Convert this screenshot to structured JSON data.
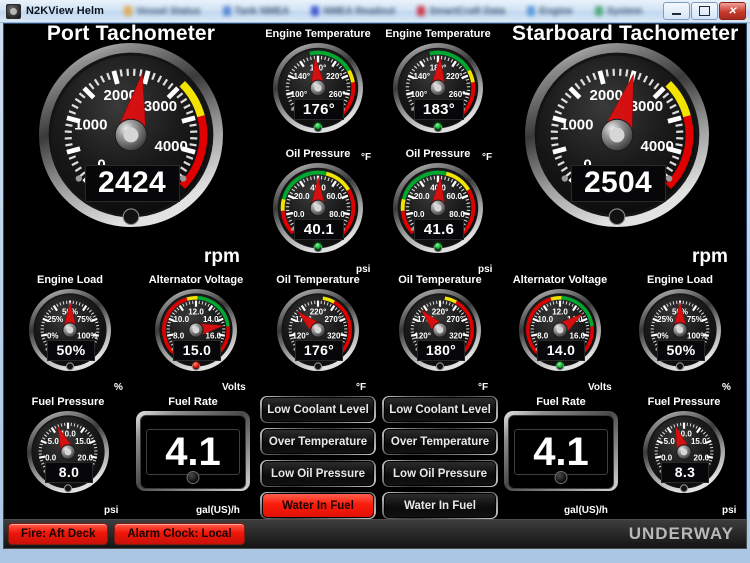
{
  "window": {
    "title": "N2KView Helm",
    "app_icon": "app-icon",
    "tabs": [
      {
        "label": "Vessel Status",
        "dot": "#e2a33a"
      },
      {
        "label": "Tank NMEA",
        "dot": "#4a7fd0"
      },
      {
        "label": "NMEA Readout",
        "dot": "#2a46c8"
      },
      {
        "label": "SmartCraft Data",
        "dot": "#cc2233"
      },
      {
        "label": "Engine",
        "dot": "#4a8fd8"
      },
      {
        "label": "System",
        "dot": "#3fa06a"
      }
    ],
    "controls": {
      "minimize": "minimize-button",
      "maximize": "maximize-button",
      "close": "close-button"
    }
  },
  "status_bar": {
    "alarms": [
      "Fire: Aft Deck",
      "Alarm Clock: Local"
    ],
    "vessel_state": "UNDERWAY"
  },
  "alarm_buttons": {
    "port": [
      {
        "label": "Low Coolant Level",
        "active": false
      },
      {
        "label": "Over Temperature",
        "active": false
      },
      {
        "label": "Low Oil Pressure",
        "active": false
      },
      {
        "label": "Water In Fuel",
        "active": true
      }
    ],
    "starboard": [
      {
        "label": "Low Coolant Level",
        "active": false
      },
      {
        "label": "Over Temperature",
        "active": false
      },
      {
        "label": "Low Oil Pressure",
        "active": false
      },
      {
        "label": "Water In Fuel",
        "active": false
      }
    ]
  },
  "colors": {
    "green": "#00a830",
    "yellow": "#f2e400",
    "red": "#e00000",
    "needle": "#d51010",
    "alarm_red": "#f01608",
    "text": "#ffffff"
  },
  "gauges": {
    "port_tach": {
      "title": "Port Tachometer",
      "value": "2424",
      "unit": "rpm",
      "min": 0,
      "max": 4500,
      "value_num": 2424,
      "ticks": [
        {
          "v": 0,
          "label": "0"
        },
        {
          "v": 1000,
          "label": "1000"
        },
        {
          "v": 2000,
          "label": "2000"
        },
        {
          "v": 3000,
          "label": "3000"
        },
        {
          "v": 4000,
          "label": "4000"
        }
      ],
      "bands": [
        {
          "from": 3000,
          "to": 3500,
          "color": "#f2e400"
        },
        {
          "from": 3500,
          "to": 4500,
          "color": "#e00000"
        }
      ],
      "led": null
    },
    "stbd_tach": {
      "title": "Starboard Tachometer",
      "value": "2504",
      "unit": "rpm",
      "min": 0,
      "max": 4500,
      "value_num": 2504,
      "ticks": [
        {
          "v": 0,
          "label": "0"
        },
        {
          "v": 1000,
          "label": "1000"
        },
        {
          "v": 2000,
          "label": "2000"
        },
        {
          "v": 3000,
          "label": "3000"
        },
        {
          "v": 4000,
          "label": "4000"
        }
      ],
      "bands": [
        {
          "from": 3000,
          "to": 3500,
          "color": "#f2e400"
        },
        {
          "from": 3500,
          "to": 4500,
          "color": "#e00000"
        }
      ],
      "led": null
    },
    "port_engine_temp": {
      "title": "Engine Temperature",
      "value": "176°",
      "unit": "°F",
      "min": 80,
      "max": 280,
      "value_num": 176,
      "ticks": [
        {
          "v": 100,
          "label": "100°"
        },
        {
          "v": 140,
          "label": "140°"
        },
        {
          "v": 180,
          "label": "180°"
        },
        {
          "v": 220,
          "label": "220°"
        },
        {
          "v": 260,
          "label": "260°"
        }
      ],
      "bands": [
        {
          "from": 170,
          "to": 225,
          "color": "#00a830"
        },
        {
          "from": 225,
          "to": 240,
          "color": "#f2e400"
        },
        {
          "from": 240,
          "to": 280,
          "color": "#e00000"
        }
      ],
      "led": "green"
    },
    "stbd_engine_temp": {
      "title": "Engine Temperature",
      "value": "183°",
      "unit": "°F",
      "min": 80,
      "max": 280,
      "value_num": 183,
      "ticks": [
        {
          "v": 100,
          "label": "100°"
        },
        {
          "v": 140,
          "label": "140°"
        },
        {
          "v": 180,
          "label": "180°"
        },
        {
          "v": 220,
          "label": "220°"
        },
        {
          "v": 260,
          "label": "260°"
        }
      ],
      "bands": [
        {
          "from": 170,
          "to": 225,
          "color": "#00a830"
        },
        {
          "from": 225,
          "to": 240,
          "color": "#f2e400"
        },
        {
          "from": 240,
          "to": 280,
          "color": "#e00000"
        }
      ],
      "led": "green"
    },
    "port_oil_press": {
      "title": "Oil Pressure",
      "value": "40.1",
      "unit": "psi",
      "min": -10,
      "max": 90,
      "value_num": 40.1,
      "ticks": [
        {
          "v": 0,
          "label": "0.0"
        },
        {
          "v": 20,
          "label": "20.0"
        },
        {
          "v": 40,
          "label": "40.0"
        },
        {
          "v": 60,
          "label": "60.0"
        },
        {
          "v": 80,
          "label": "80.0"
        }
      ],
      "bands": [
        {
          "from": -10,
          "to": 5,
          "color": "#e00000"
        },
        {
          "from": 5,
          "to": 12,
          "color": "#f2e400"
        },
        {
          "from": 12,
          "to": 45,
          "color": "#00a830"
        },
        {
          "from": 45,
          "to": 62,
          "color": "#f2e400"
        },
        {
          "from": 62,
          "to": 90,
          "color": "#e00000"
        }
      ],
      "led": "green"
    },
    "stbd_oil_press": {
      "title": "Oil Pressure",
      "value": "41.6",
      "unit": "psi",
      "min": -10,
      "max": 90,
      "value_num": 41.6,
      "ticks": [
        {
          "v": 0,
          "label": "0.0"
        },
        {
          "v": 20,
          "label": "20.0"
        },
        {
          "v": 40,
          "label": "40.0"
        },
        {
          "v": 60,
          "label": "60.0"
        },
        {
          "v": 80,
          "label": "80.0"
        }
      ],
      "bands": [
        {
          "from": -10,
          "to": 5,
          "color": "#e00000"
        },
        {
          "from": 5,
          "to": 12,
          "color": "#f2e400"
        },
        {
          "from": 12,
          "to": 45,
          "color": "#00a830"
        },
        {
          "from": 45,
          "to": 62,
          "color": "#f2e400"
        },
        {
          "from": 62,
          "to": 90,
          "color": "#e00000"
        }
      ],
      "led": "green"
    },
    "port_engine_load": {
      "title": "Engine Load",
      "value": "50%",
      "unit": "%",
      "min": -12,
      "max": 112,
      "value_num": 50,
      "ticks": [
        {
          "v": 0,
          "label": "0%"
        },
        {
          "v": 25,
          "label": "25%"
        },
        {
          "v": 50,
          "label": "50%"
        },
        {
          "v": 75,
          "label": "75%"
        },
        {
          "v": 100,
          "label": "100%"
        }
      ],
      "bands": [],
      "led": null
    },
    "stbd_engine_load": {
      "title": "Engine Load",
      "value": "50%",
      "unit": "%",
      "min": -12,
      "max": 112,
      "value_num": 50,
      "ticks": [
        {
          "v": 0,
          "label": "0%"
        },
        {
          "v": 25,
          "label": "25%"
        },
        {
          "v": 50,
          "label": "50%"
        },
        {
          "v": 75,
          "label": "75%"
        },
        {
          "v": 100,
          "label": "100%"
        }
      ],
      "bands": [],
      "led": null
    },
    "port_alt_volt": {
      "title": "Alternator Voltage",
      "value": "15.0",
      "unit": "Volts",
      "min": 7,
      "max": 17,
      "value_num": 15.0,
      "ticks": [
        {
          "v": 8,
          "label": "8.0"
        },
        {
          "v": 10,
          "label": "10.0"
        },
        {
          "v": 12,
          "label": "12.0"
        },
        {
          "v": 14,
          "label": "14.0"
        },
        {
          "v": 16,
          "label": "16.0"
        }
      ],
      "bands": [
        {
          "from": 7,
          "to": 11.4,
          "color": "#e00000"
        },
        {
          "from": 11.4,
          "to": 12.1,
          "color": "#f2e400"
        },
        {
          "from": 12.1,
          "to": 15.1,
          "color": "#00a830"
        },
        {
          "from": 15.1,
          "to": 17,
          "color": "#e00000"
        }
      ],
      "led": "red"
    },
    "stbd_alt_volt": {
      "title": "Alternator Voltage",
      "value": "14.0",
      "unit": "Volts",
      "min": 7,
      "max": 17,
      "value_num": 14.0,
      "ticks": [
        {
          "v": 8,
          "label": "8.0"
        },
        {
          "v": 10,
          "label": "10.0"
        },
        {
          "v": 12,
          "label": "12.0"
        },
        {
          "v": 14,
          "label": "14.0"
        },
        {
          "v": 16,
          "label": "16.0"
        }
      ],
      "bands": [
        {
          "from": 7,
          "to": 11.4,
          "color": "#e00000"
        },
        {
          "from": 11.4,
          "to": 12.1,
          "color": "#f2e400"
        },
        {
          "from": 12.1,
          "to": 15.1,
          "color": "#00a830"
        },
        {
          "from": 15.1,
          "to": 17,
          "color": "#e00000"
        }
      ],
      "led": "green"
    },
    "port_oil_temp": {
      "title": "Oil Temperature",
      "value": "176°",
      "unit": "°F",
      "min": 95,
      "max": 345,
      "value_num": 176,
      "ticks": [
        {
          "v": 120,
          "label": "120°"
        },
        {
          "v": 170,
          "label": "170°"
        },
        {
          "v": 220,
          "label": "220°"
        },
        {
          "v": 270,
          "label": "270°"
        },
        {
          "v": 320,
          "label": "320°"
        }
      ],
      "bands": [
        {
          "from": 228,
          "to": 248,
          "color": "#f2e400"
        },
        {
          "from": 248,
          "to": 345,
          "color": "#e00000"
        }
      ],
      "led": null
    },
    "stbd_oil_temp": {
      "title": "Oil Temperature",
      "value": "180°",
      "unit": "°F",
      "min": 95,
      "max": 345,
      "value_num": 180,
      "ticks": [
        {
          "v": 120,
          "label": "120°"
        },
        {
          "v": 170,
          "label": "170°"
        },
        {
          "v": 220,
          "label": "220°"
        },
        {
          "v": 270,
          "label": "270°"
        },
        {
          "v": 320,
          "label": "320°"
        }
      ],
      "bands": [
        {
          "from": 228,
          "to": 248,
          "color": "#f2e400"
        },
        {
          "from": 248,
          "to": 345,
          "color": "#e00000"
        }
      ],
      "led": null
    },
    "port_fuel_press": {
      "title": "Fuel Pressure",
      "value": "8.0",
      "unit": "psi",
      "min": -2.5,
      "max": 22.5,
      "value_num": 8.0,
      "ticks": [
        {
          "v": 0,
          "label": "0.0"
        },
        {
          "v": 5,
          "label": "5.0"
        },
        {
          "v": 10,
          "label": "10.0"
        },
        {
          "v": 15,
          "label": "15.0"
        },
        {
          "v": 20,
          "label": "20.0"
        }
      ],
      "bands": [],
      "led": null
    },
    "stbd_fuel_press": {
      "title": "Fuel Pressure",
      "value": "8.3",
      "unit": "psi",
      "min": -2.5,
      "max": 22.5,
      "value_num": 8.3,
      "ticks": [
        {
          "v": 0,
          "label": "0.0"
        },
        {
          "v": 5,
          "label": "5.0"
        },
        {
          "v": 10,
          "label": "10.0"
        },
        {
          "v": 15,
          "label": "15.0"
        },
        {
          "v": 20,
          "label": "20.0"
        }
      ],
      "bands": [],
      "led": null
    },
    "port_fuel_rate": {
      "title": "Fuel Rate",
      "value": "4.1",
      "unit": "gal(US)/h"
    },
    "stbd_fuel_rate": {
      "title": "Fuel Rate",
      "value": "4.1",
      "unit": "gal(US)/h"
    }
  }
}
